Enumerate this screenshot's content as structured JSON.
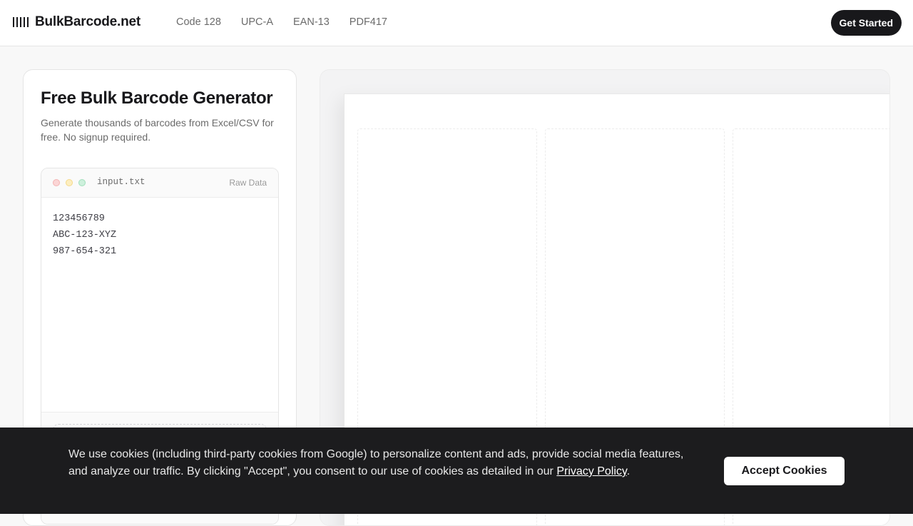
{
  "header": {
    "brand": "BulkBarcode.net",
    "nav": [
      "Code 128",
      "UPC-A",
      "EAN-13",
      "PDF417"
    ],
    "cta": "Get Started"
  },
  "panel": {
    "title": "Free Bulk Barcode Generator",
    "subtitle": "Generate thousands of barcodes from Excel/CSV for free. No signup required."
  },
  "editor": {
    "filename": "input.txt",
    "mode_label": "Raw Data",
    "lines": [
      "123456789",
      "ABC-123-XYZ",
      "987-654-321"
    ]
  },
  "cookie": {
    "text": "We use cookies (including third-party cookies from Google) to personalize content and ads, provide social media features, and analyze our traffic. By clicking \"Accept\", you consent to our use of cookies as detailed in our ",
    "link": "Privacy Policy",
    "end": ".",
    "button": "Accept Cookies"
  },
  "icons": {
    "brand": "barcode-icon",
    "window_controls": [
      "close-dot-icon",
      "minimize-dot-icon",
      "maximize-dot-icon"
    ]
  }
}
